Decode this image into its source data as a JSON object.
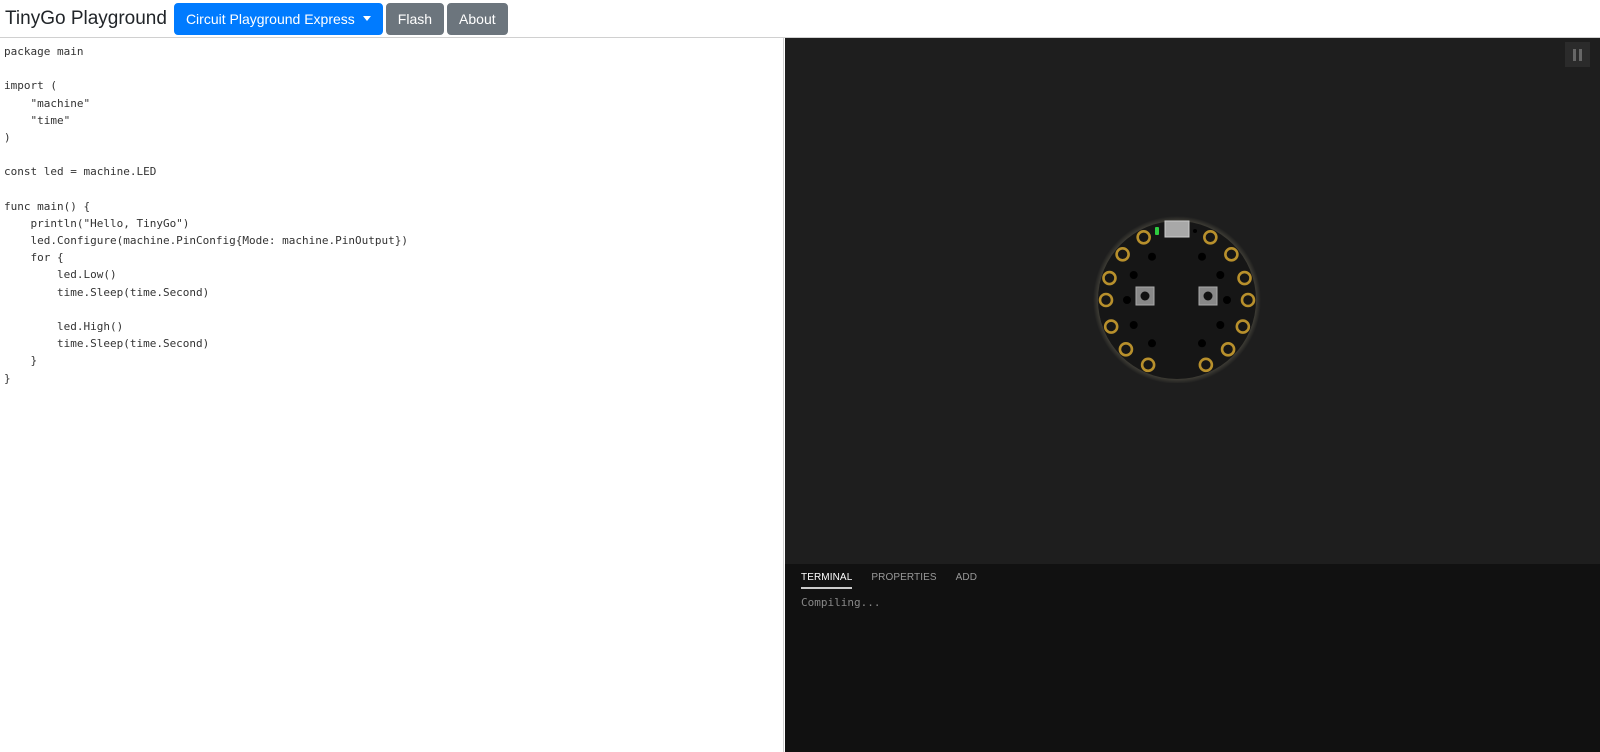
{
  "navbar": {
    "brand": "TinyGo Playground",
    "board_select": "Circuit Playground Express",
    "flash": "Flash",
    "about": "About"
  },
  "editor": {
    "lines": [
      "package main",
      "",
      "import (",
      "    \"machine\"",
      "    \"time\"",
      ")",
      "",
      "const led = machine.LED",
      "",
      "func main() {",
      "    println(\"Hello, TinyGo\")",
      "    led.Configure(machine.PinConfig{Mode: machine.PinOutput})",
      "    for {",
      "        led.Low()",
      "        time.Sleep(time.Second)",
      "",
      "        led.High()",
      "        time.Sleep(time.Second)",
      "    }",
      "}"
    ]
  },
  "simulator": {
    "pause_icon": "pause-icon",
    "board_icon": "circuit-playground-board",
    "led_color": "#2ecc40",
    "pad_color": "#b8902c"
  },
  "terminal": {
    "tabs": [
      "TERMINAL",
      "PROPERTIES",
      "ADD"
    ],
    "active_tab": 0,
    "output": "Compiling..."
  }
}
